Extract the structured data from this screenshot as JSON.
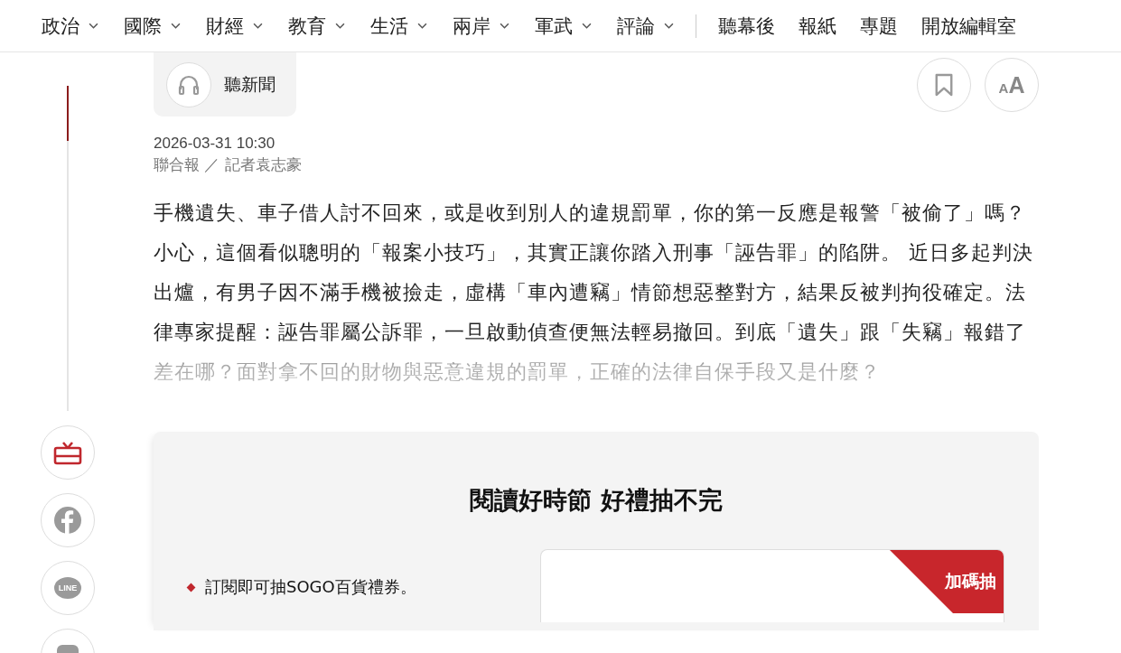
{
  "nav": {
    "menus": [
      {
        "label": "政治"
      },
      {
        "label": "國際"
      },
      {
        "label": "財經"
      },
      {
        "label": "教育"
      },
      {
        "label": "生活"
      },
      {
        "label": "兩岸"
      },
      {
        "label": "軍武"
      },
      {
        "label": "評論"
      }
    ],
    "links": [
      "聽幕後",
      "報紙",
      "專題",
      "開放編輯室"
    ]
  },
  "reading_progress": {
    "level": 0.17
  },
  "share_rail": [
    {
      "kind": "gift"
    },
    {
      "kind": "facebook"
    },
    {
      "kind": "line",
      "label": "LINE"
    },
    {
      "kind": "more"
    }
  ],
  "article": {
    "listen_button": "聽新聞",
    "font_size_button": [
      "A",
      "A"
    ],
    "date": "2026-03-31 10:30",
    "byline": "聯合報 ／ 記者袁志豪",
    "lead": "手機遺失、車子借人討不回來，或是收到別人的違規罰單，你的第一反應是報警「被偷了」嗎？小心，這個看似聰明的「報案小技巧」，其實正讓你踏入刑事「誣告罪」的陷阱。 近日多起判決出爐，有男子因不滿手機被撿走，虛構「車內遭竊」情節想惡整對方，結果反被判拘役確定。法律專家提醒：誣告罪屬公訴罪，一旦啟動偵查便無法輕易撤回。到底「遺失」跟「失竊」報錯了差在哪？面對拿不回的財物與惡意違規的罰單，正確的法律自保手段又是什麼？"
  },
  "promo": {
    "title": "閱讀好時節 好禮抽不完",
    "bullets": [
      "訂閱即可抽SOGO百貨禮券。"
    ],
    "card_badge": "加碼抽"
  }
}
